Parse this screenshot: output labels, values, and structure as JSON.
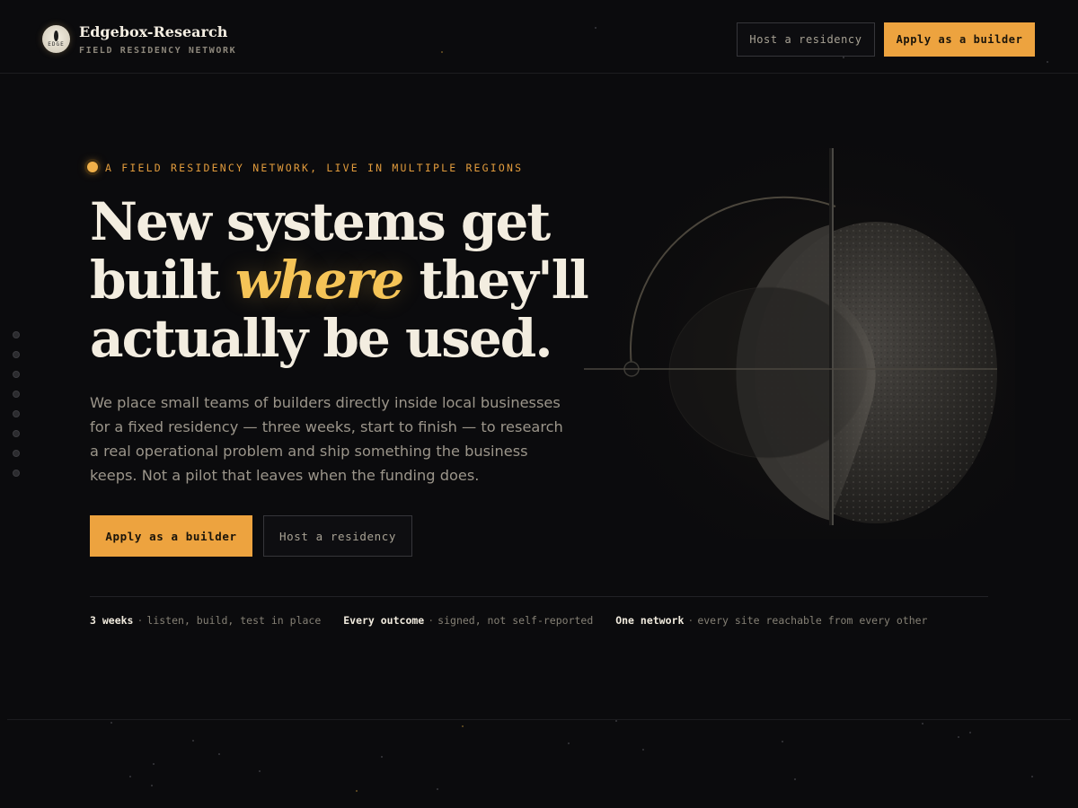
{
  "header": {
    "brand_name": "Edgebox-Research",
    "brand_tagline": "FIELD RESIDENCY NETWORK",
    "logo_text": "EDGE",
    "host_label": "Host a residency",
    "apply_label": "Apply as a builder"
  },
  "hero": {
    "eyebrow": "A FIELD RESIDENCY NETWORK, LIVE IN MULTIPLE REGIONS",
    "headline": {
      "line1": "New systems get",
      "line2_before": "built ",
      "line2_accent": "where",
      "line2_after": " they'll",
      "line3": "actually be used."
    },
    "lede": "We place small teams of builders directly inside local businesses for a fixed residency — three weeks, start to finish — to research a real operational problem and ship something the business keeps. Not a pilot that leaves when the funding does.",
    "cta_primary": "Apply as a builder",
    "cta_secondary": "Host a residency"
  },
  "stats": [
    {
      "label": "3 weeks",
      "sep": "·",
      "desc": "listen, build, test in place"
    },
    {
      "label": "Every outcome",
      "sep": "·",
      "desc": "signed, not self-reported"
    },
    {
      "label": "One network",
      "sep": "·",
      "desc": "every site reachable from every other"
    }
  ],
  "colors": {
    "background": "#0b0b0d",
    "accent": "#eda33f",
    "headline_accent": "#f5c457",
    "text": "#f3ede0"
  }
}
